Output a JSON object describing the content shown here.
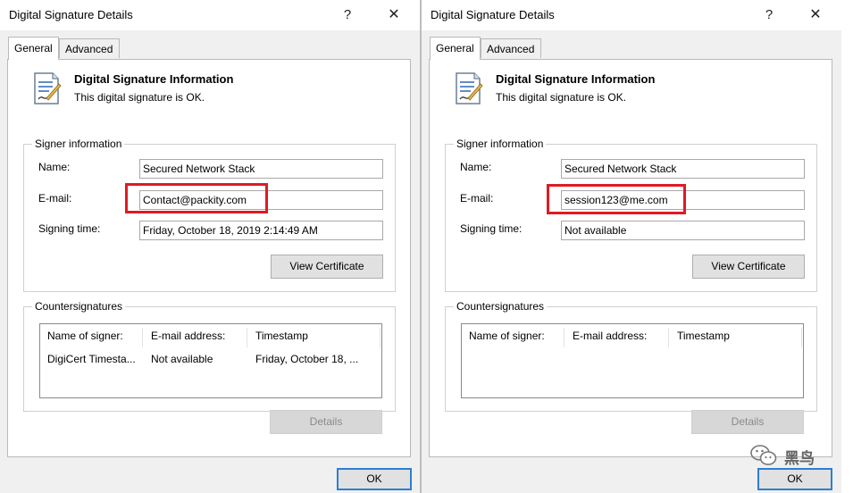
{
  "dialogs": {
    "left": {
      "title": "Digital Signature Details",
      "help_label": "?",
      "close_label": "✕",
      "tabs": [
        "General",
        "Advanced"
      ],
      "heading": "Digital Signature Information",
      "status": "This digital signature is OK.",
      "signer_group_label": "Signer information",
      "name_label": "Name:",
      "name_value": "Secured Network Stack",
      "email_label": "E-mail:",
      "email_value": "Contact@packity.com",
      "signing_time_label": "Signing time:",
      "signing_time_value": "Friday, October 18, 2019 2:14:49 AM",
      "view_certificate_label": "View Certificate",
      "counter_group_label": "Countersignatures",
      "columns": [
        "Name of signer:",
        "E-mail address:",
        "Timestamp"
      ],
      "rows": [
        [
          "DigiCert Timesta...",
          "Not available",
          "Friday, October 18, ..."
        ]
      ],
      "details_label": "Details",
      "ok_label": "OK"
    },
    "right": {
      "title": "Digital Signature Details",
      "help_label": "?",
      "close_label": "✕",
      "tabs": [
        "General",
        "Advanced"
      ],
      "heading": "Digital Signature Information",
      "status": "This digital signature is OK.",
      "signer_group_label": "Signer information",
      "name_label": "Name:",
      "name_value": "Secured Network Stack",
      "email_label": "E-mail:",
      "email_value": "session123@me.com",
      "signing_time_label": "Signing time:",
      "signing_time_value": "Not available",
      "view_certificate_label": "View Certificate",
      "counter_group_label": "Countersignatures",
      "columns": [
        "Name of signer:",
        "E-mail address:",
        "Timestamp"
      ],
      "rows": [],
      "details_label": "Details",
      "ok_label": "OK"
    }
  },
  "highlight_color": "#e01a23",
  "watermark": {
    "text": "黑鸟",
    "icon": "wechat-icon"
  }
}
